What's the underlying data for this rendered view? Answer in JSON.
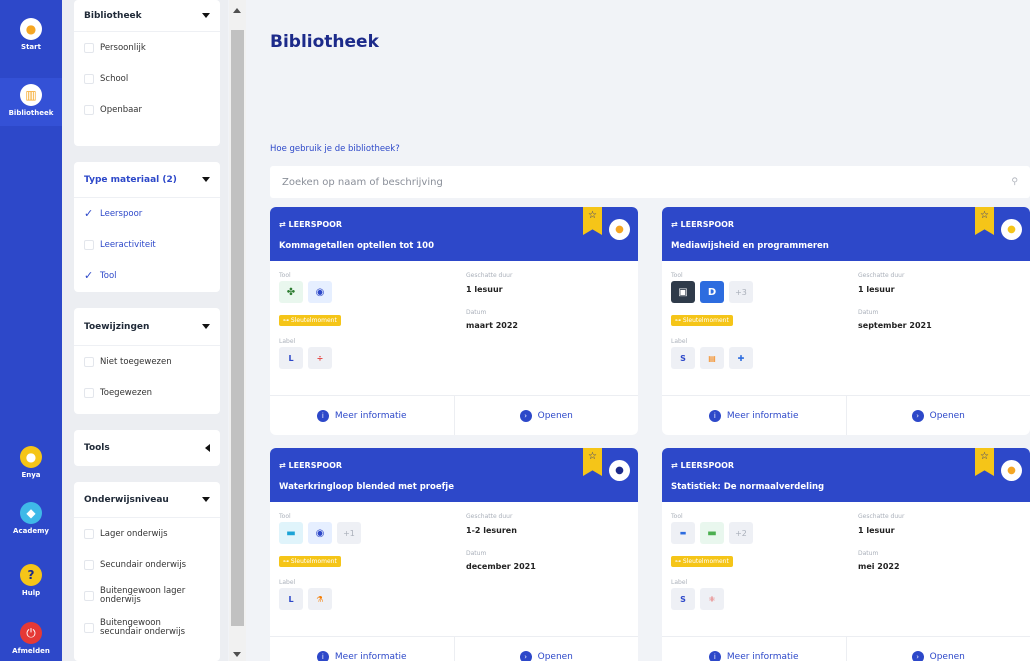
{
  "nav": {
    "items": [
      {
        "label": "Start",
        "icon": "start-logo-icon"
      },
      {
        "label": "Bibliotheek",
        "icon": "library-icon"
      },
      {
        "label": "Enya",
        "icon": "user-avatar-icon"
      },
      {
        "label": "Academy",
        "icon": "academy-icon"
      },
      {
        "label": "Hulp",
        "icon": "help-icon"
      },
      {
        "label": "Afmelden",
        "icon": "power-icon"
      }
    ]
  },
  "filters": {
    "bibliotheek": {
      "title": "Bibliotheek",
      "options": [
        "Persoonlijk",
        "School",
        "Openbaar"
      ]
    },
    "type": {
      "title": "Type materiaal (2)",
      "options": [
        {
          "label": "Leerspoor",
          "checked": true
        },
        {
          "label": "Leeractiviteit",
          "checked": false
        },
        {
          "label": "Tool",
          "checked": true
        }
      ]
    },
    "toewijzingen": {
      "title": "Toewijzingen",
      "options": [
        "Niet toegewezen",
        "Toegewezen"
      ]
    },
    "tools": {
      "title": "Tools"
    },
    "onderwijs": {
      "title": "Onderwijsniveau",
      "options": [
        "Lager onderwijs",
        "Secundair onderwijs",
        "Buitengewoon lager onderwijs",
        "Buitengewoon secundair onderwijs"
      ]
    }
  },
  "main": {
    "title": "Bibliotheek",
    "help_link": "Hoe gebruik je de bibliotheek?",
    "search_placeholder": "Zoeken op naam of beschrijving"
  },
  "card_labels": {
    "type": "LEERSPOOR",
    "tool": "Tool",
    "duur": "Geschatte duur",
    "datum": "Datum",
    "label": "Label",
    "sleutel": "Sleutelmoment",
    "more_info": "Meer informatie",
    "open": "Openen"
  },
  "cards": [
    {
      "title": "Kommagetallen optellen tot 100",
      "duration": "1 lesuur",
      "date": "maart 2022",
      "more_tools": "",
      "labels": [
        "L",
        "÷"
      ]
    },
    {
      "title": "Mediawijsheid en programmeren",
      "duration": "1 lesuur",
      "date": "september 2021",
      "more_tools": "+3",
      "labels": [
        "S",
        "▤",
        "✚"
      ]
    },
    {
      "title": "Waterkringloop blended met proefje",
      "duration": "1-2 lesuren",
      "date": "december 2021",
      "more_tools": "+1",
      "labels": [
        "L",
        "⚗"
      ]
    },
    {
      "title": "Statistiek: De normaalverdeling",
      "duration": "1 lesuur",
      "date": "mei 2022",
      "more_tools": "+2",
      "labels": [
        "S",
        "⚛"
      ]
    }
  ],
  "colors": {
    "primary": "#2d48c9",
    "accent": "#f5c518",
    "title": "#1c2a8a"
  }
}
